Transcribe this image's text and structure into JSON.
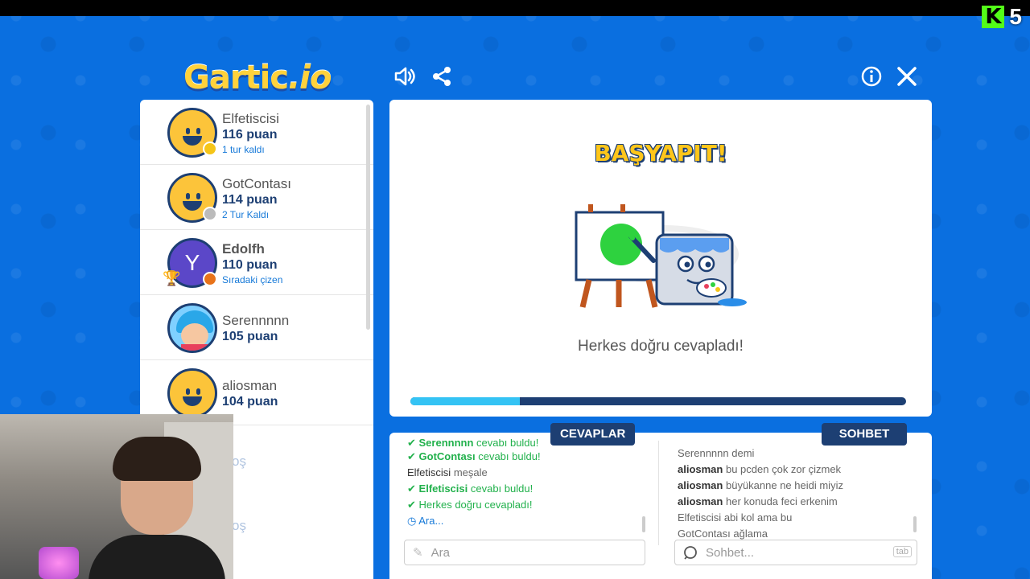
{
  "app": {
    "logo": "Gartic",
    "logo_suffix": "io"
  },
  "stream": {
    "viewer_count": "5"
  },
  "players": [
    {
      "name": "Elfetiscisi",
      "score": "116 puan",
      "note": "1 tur kaldı",
      "status_color": "#f5c518",
      "avatar": "smiley"
    },
    {
      "name": "GotContası",
      "score": "114 puan",
      "note": "2 Tur Kaldı",
      "status_color": "#bbbbbb",
      "avatar": "smiley"
    },
    {
      "name": "Edolfh",
      "score": "110 puan",
      "note": "Sıradaki çizen",
      "status_color": "#e8731a",
      "avatar": "Y",
      "rank": "1"
    },
    {
      "name": "Serennnnn",
      "score": "105 puan",
      "note": "",
      "avatar": "girl"
    },
    {
      "name": "aliosman",
      "score": "104 puan",
      "note": "",
      "avatar": "smiley"
    }
  ],
  "empty_slots": [
    "oş",
    "oş"
  ],
  "canvas": {
    "banner": "BAŞYAPIT!",
    "result": "Herkes doğru cevapladı!",
    "progress": 0.22
  },
  "answers": {
    "tab": "CEVAPLAR",
    "lines": [
      {
        "type": "ok",
        "user": "Serennnnn",
        "text": "cevabı buldu!"
      },
      {
        "type": "ok",
        "user": "GotContası",
        "text": "cevabı buldu!"
      },
      {
        "type": "plain",
        "user": "Elfetiscisi",
        "text": "meşale"
      },
      {
        "type": "ok",
        "user": "Elfetiscisi",
        "text": "cevabı buldu!"
      },
      {
        "type": "ok",
        "user": "",
        "text": "Herkes doğru cevapladı!"
      },
      {
        "type": "clock",
        "user": "",
        "text": "Ara..."
      }
    ],
    "placeholder": "Ara"
  },
  "chat": {
    "tab": "SOHBET",
    "lines": [
      {
        "user": "Serennnnn",
        "text": "demi"
      },
      {
        "user": "aliosman",
        "text": "bu pcden çok zor çizmek"
      },
      {
        "user": "aliosman",
        "text": "büyükanne ne heidi miyiz"
      },
      {
        "user": "aliosman",
        "text": "her konuda feci erkenim"
      },
      {
        "user": "Elfetiscisi",
        "text": "abi kol ama bu"
      },
      {
        "user": "GotContası",
        "text": "ağlama"
      }
    ],
    "placeholder": "Sohbet...",
    "key_hint": "tab"
  },
  "colors": {
    "background": "#0a6fe0",
    "navy": "#1d3f73",
    "accent_green": "#22b14c",
    "progress": "#34c3f4"
  }
}
